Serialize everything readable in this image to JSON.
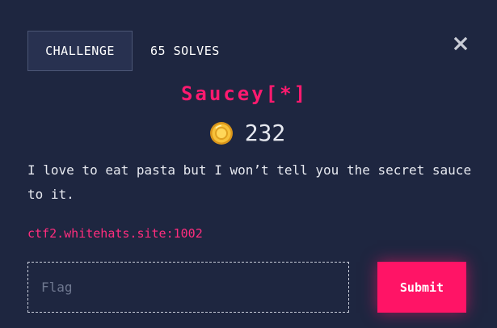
{
  "tabs": {
    "active_label": "CHALLENGE",
    "solves_label": "65 SOLVES"
  },
  "challenge": {
    "title": "Saucey[*]",
    "points": "232",
    "description": "I love to eat pasta but I won’t tell you the secret sauce to it.",
    "link": "ctf2.whitehats.site:1002"
  },
  "form": {
    "flag_placeholder": "Flag",
    "submit_label": "Submit"
  },
  "icons": {
    "close": "close-icon",
    "coin": "coin-icon"
  },
  "colors": {
    "background": "#1e2640",
    "accent": "#ff1466",
    "title": "#ff1a6f",
    "coin": "#f5b82e"
  }
}
